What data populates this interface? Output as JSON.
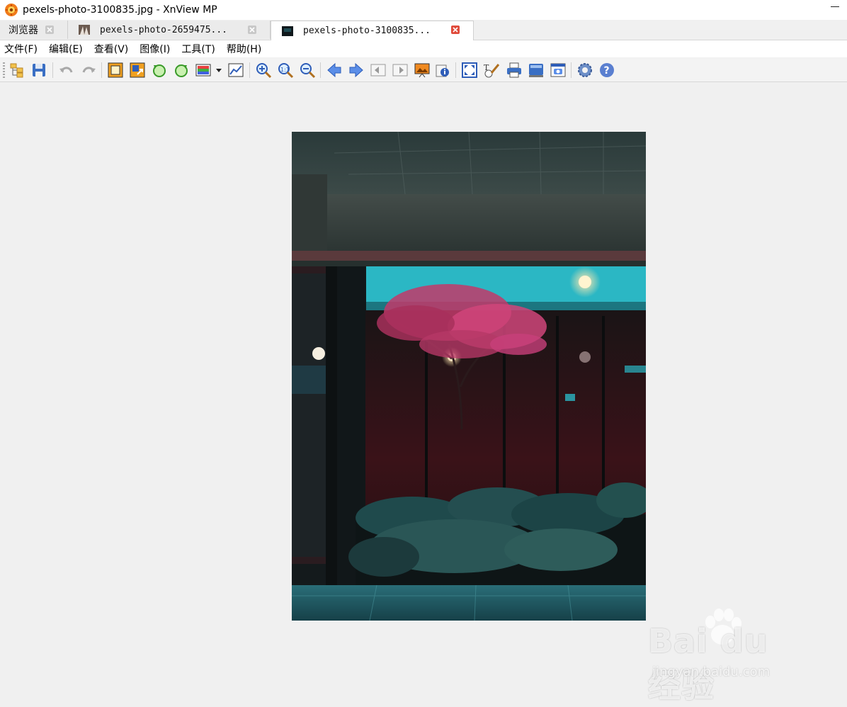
{
  "window": {
    "title": "pexels-photo-3100835.jpg - XnView MP",
    "icon": "xnview-app-icon"
  },
  "tabs": [
    {
      "label": "浏览器",
      "icon": "browser-icon",
      "active": false
    },
    {
      "label": "pexels-photo-2659475...",
      "icon": "image-thumbnail",
      "active": false
    },
    {
      "label": "pexels-photo-3100835...",
      "icon": "image-thumbnail",
      "active": true
    }
  ],
  "menu": [
    {
      "label": "文件(F)"
    },
    {
      "label": "编辑(E)"
    },
    {
      "label": "查看(V)"
    },
    {
      "label": "图像(I)"
    },
    {
      "label": "工具(T)"
    },
    {
      "label": "帮助(H)"
    }
  ],
  "toolbar": {
    "buttons": [
      "open-browser-icon",
      "save-icon",
      "undo-icon",
      "redo-icon",
      "crop-icon",
      "resize-icon",
      "rotate-left-icon",
      "rotate-right-icon",
      "color-adjust-icon",
      "dropdown-arrow-icon",
      "histogram-icon",
      "zoom-in-icon",
      "zoom-actual-icon",
      "zoom-out-icon",
      "previous-icon",
      "next-icon",
      "first-icon",
      "last-icon",
      "slideshow-icon",
      "info-icon",
      "fit-window-icon",
      "edit-text-icon",
      "print-icon",
      "scanner-icon",
      "capture-icon",
      "settings-icon",
      "help-icon"
    ]
  },
  "watermark": {
    "main": "Bai du 经验",
    "sub": "jingyan.baidu.com"
  },
  "colors": {
    "accent_close": "#e04b3b",
    "background": "#f0f0f0"
  }
}
